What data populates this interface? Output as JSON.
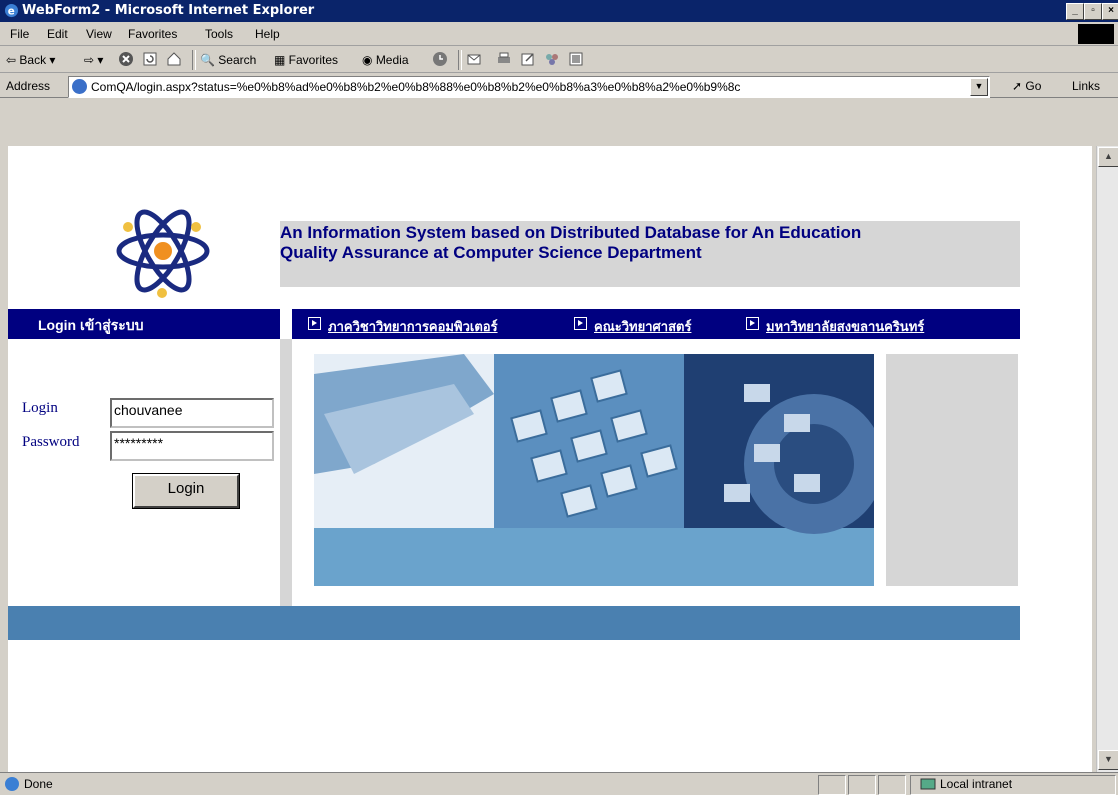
{
  "window": {
    "title": "WebForm2 - Microsoft Internet Explorer"
  },
  "menu": [
    "File",
    "Edit",
    "View",
    "Favorites",
    "Tools",
    "Help"
  ],
  "toolbar": {
    "back": "Back",
    "search": "Search",
    "favorites": "Favorites",
    "media": "Media"
  },
  "address": {
    "label": "Address",
    "url": "ComQA/login.aspx?status=%e0%b8%ad%e0%b8%b2%e0%b8%88%e0%b8%b2%e0%b8%a3%e0%b8%a2%e0%b9%8c",
    "go": "Go",
    "links": "Links"
  },
  "page": {
    "title_line1": "An Information System based on Distributed Database for An Education",
    "title_line2": "Quality Assurance at Computer Science Department",
    "login_bar": "Login เข้าสู่ระบบ",
    "nav": [
      "ภาควิชาวิทยาการคอมพิวเตอร์",
      "คณะวิทยาศาสตร์",
      "มหาวิทยาลัยสงขลานครินทร์"
    ],
    "login_label": "Login",
    "password_label": "Password",
    "login_value": "chouvanee",
    "password_value": "*********",
    "login_button": "Login"
  },
  "status": {
    "text": "Done",
    "zone": "Local intranet"
  },
  "colors": {
    "nav_bg": "#000080",
    "banner": "#6aa3cc",
    "footer": "#4a80b0"
  }
}
